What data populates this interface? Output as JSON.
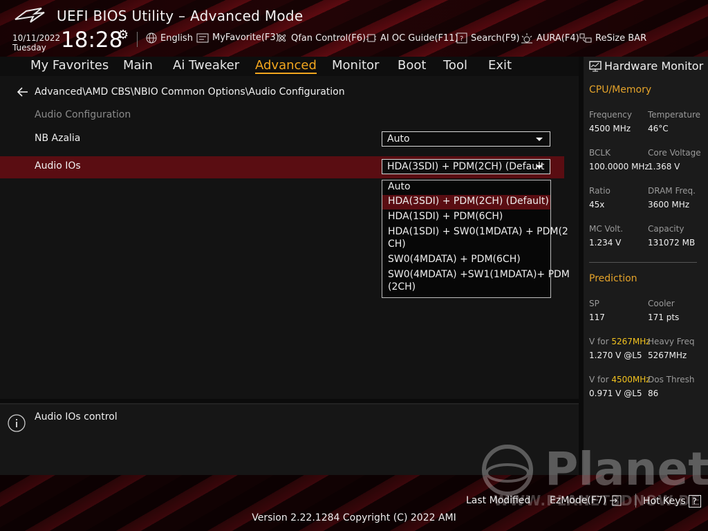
{
  "app": {
    "title": "UEFI BIOS Utility – Advanced Mode"
  },
  "header": {
    "date": "10/11/2022",
    "weekday": "Tuesday",
    "time": "18:28",
    "tools": {
      "language": "English",
      "myfavorite": "MyFavorite(F3)",
      "qfan": "Qfan Control(F6)",
      "aioc": "AI OC Guide(F11)",
      "search": "Search(F9)",
      "aura": "AURA(F4)",
      "resizebar": "ReSize BAR"
    }
  },
  "nav": {
    "items": [
      "My Favorites",
      "Main",
      "Ai Tweaker",
      "Advanced",
      "Monitor",
      "Boot",
      "Tool",
      "Exit"
    ],
    "active": "Advanced"
  },
  "main": {
    "breadcrumb": "Advanced\\AMD CBS\\NBIO Common Options\\Audio Configuration",
    "section_title": "Audio Configuration",
    "rows": [
      {
        "label": "NB Azalia",
        "value": "Auto"
      },
      {
        "label": "Audio IOs",
        "value": "HDA(3SDI) + PDM(2CH) (Default"
      }
    ],
    "dropdown_options": [
      "Auto",
      "HDA(3SDI) + PDM(2CH) (Default)",
      "HDA(1SDI) + PDM(6CH)",
      "HDA(1SDI) + SW0(1MDATA) + PDM(2",
      "CH)",
      "SW0(4MDATA) + PDM(6CH)",
      "SW0(4MDATA) +SW1(1MDATA)+ PDM",
      "(2CH)"
    ],
    "selected_option": "HDA(3SDI) + PDM(2CH) (Default)"
  },
  "help": {
    "text": "Audio IOs control"
  },
  "hardware_monitor": {
    "title": "Hardware Monitor",
    "cpu_memory": {
      "heading": "CPU/Memory",
      "frequency_label": "Frequency",
      "frequency": "4500 MHz",
      "temperature_label": "Temperature",
      "temperature": "46°C",
      "bclk_label": "BCLK",
      "bclk": "100.0000 MHz",
      "core_voltage_label": "Core Voltage",
      "core_voltage": "1.368 V",
      "ratio_label": "Ratio",
      "ratio": "45x",
      "dram_freq_label": "DRAM Freq.",
      "dram_freq": "3600 MHz",
      "mc_volt_label": "MC Volt.",
      "mc_volt": "1.234 V",
      "capacity_label": "Capacity",
      "capacity": "131072 MB"
    },
    "prediction": {
      "heading": "Prediction",
      "sp_label": "SP",
      "sp": "117",
      "cooler_label": "Cooler",
      "cooler": "171 pts",
      "v_for_label": "V for",
      "v_for_freq1": "5267MHz",
      "v_for_value1": "1.270 V @L5",
      "heavy_freq_label": "Heavy Freq",
      "heavy_freq": "5267MHz",
      "v_for_freq2": "4500MHz",
      "v_for_value2": "0.971 V @L5",
      "dos_thresh_label": "Dos Thresh",
      "dos_thresh": "86"
    }
  },
  "footer": {
    "last_modified": "Last Modified",
    "ezmode": "EzMode(F7)",
    "hotkeys": "Hot Keys",
    "hotkeys_key": "?",
    "version": "Version 2.22.1284 Copyright (C) 2022 AMI"
  },
  "watermark": {
    "brand": "Planet",
    "url": "WWW.PLANET3DNOW.DE"
  },
  "colors": {
    "accent": "#f2a61e",
    "selection": "#5a0d12",
    "highlight": "#f2c21e"
  }
}
